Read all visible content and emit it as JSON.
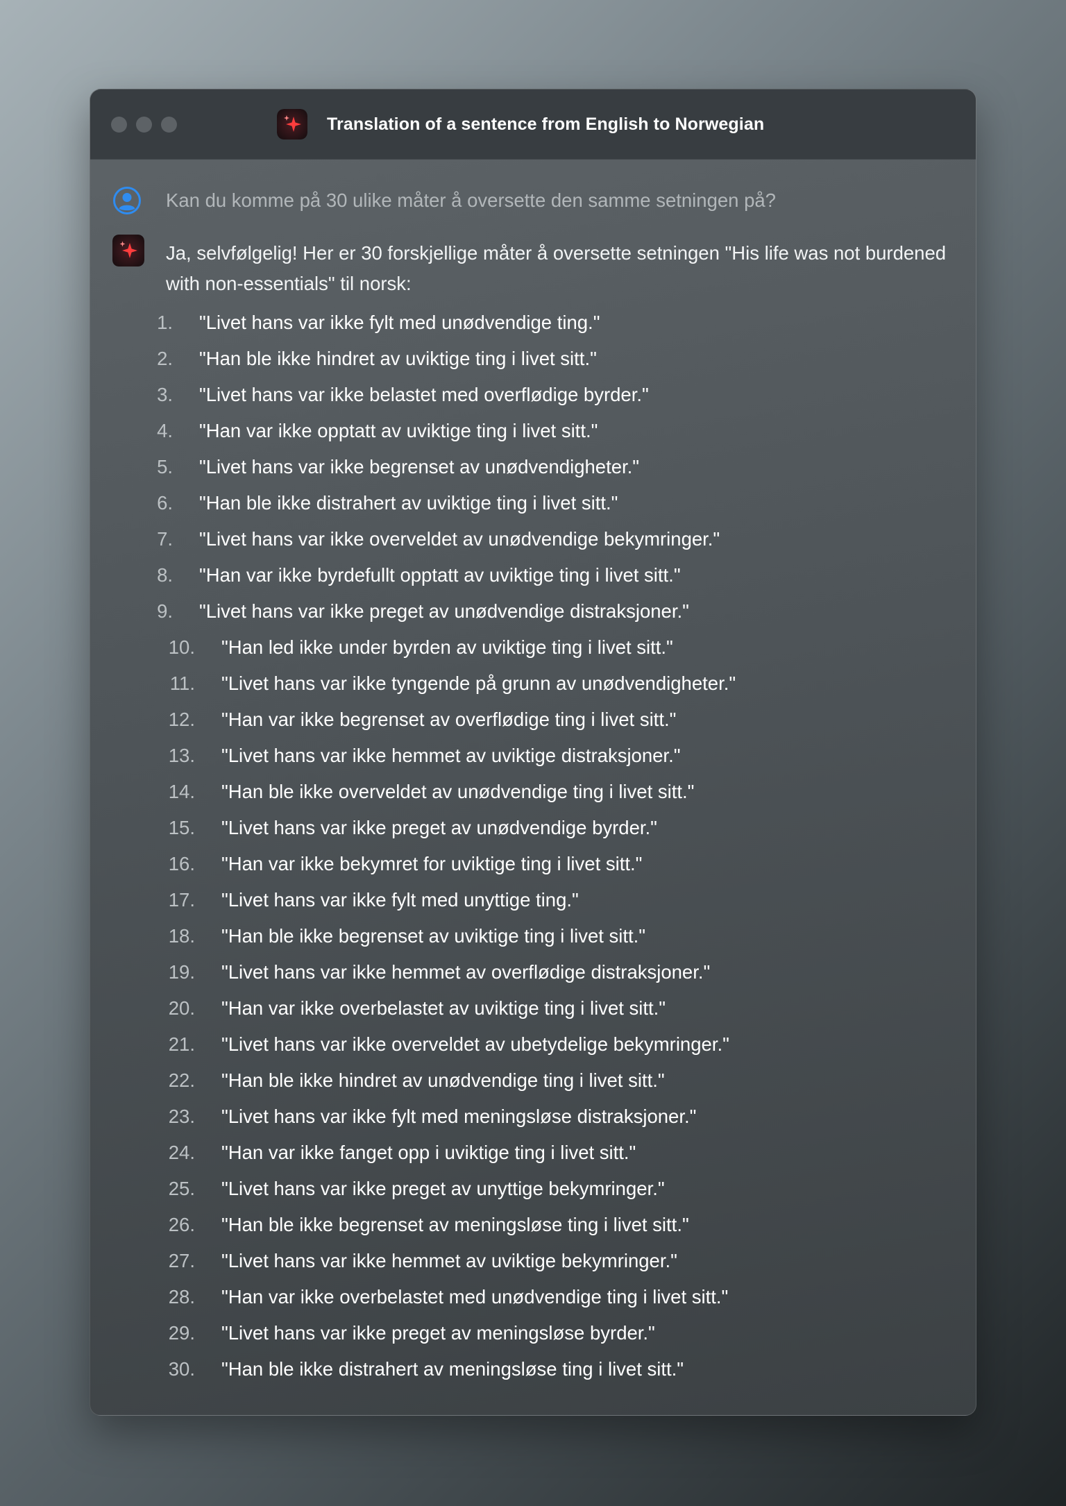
{
  "window": {
    "title": "Translation of a sentence from English to Norwegian",
    "controls": [
      "close",
      "minimize",
      "maximize"
    ],
    "app_icon": "sparkle-icon"
  },
  "conversation": {
    "user_message": "Kan du komme på 30 ulike måter å oversette den samme setningen på?",
    "assistant_intro": "Ja, selvfølgelig! Her er 30 forskjellige måter å oversette setningen \"His life was not burdened with non-essentials\" til norsk:",
    "items": [
      {
        "n": "1.",
        "text": "\"Livet hans var ikke fylt med unødvendige ting.\""
      },
      {
        "n": "2.",
        "text": "\"Han ble ikke hindret av uviktige ting i livet sitt.\""
      },
      {
        "n": "3.",
        "text": "\"Livet hans var ikke belastet med overflødige byrder.\""
      },
      {
        "n": "4.",
        "text": "\"Han var ikke opptatt av uviktige ting i livet sitt.\""
      },
      {
        "n": "5.",
        "text": "\"Livet hans var ikke begrenset av unødvendigheter.\""
      },
      {
        "n": "6.",
        "text": "\"Han ble ikke distrahert av uviktige ting i livet sitt.\""
      },
      {
        "n": "7.",
        "text": "\"Livet hans var ikke overveldet av unødvendige bekymringer.\""
      },
      {
        "n": "8.",
        "text": "\"Han var ikke byrdefullt opptatt av uviktige ting i livet sitt.\""
      },
      {
        "n": "9.",
        "text": "\"Livet hans var ikke preget av unødvendige distraksjoner.\""
      },
      {
        "n": "10.",
        "text": "\"Han led ikke under byrden av uviktige ting i livet sitt.\""
      },
      {
        "n": "11.",
        "text": "\"Livet hans var ikke tyngende på grunn av unødvendigheter.\""
      },
      {
        "n": "12.",
        "text": "\"Han var ikke begrenset av overflødige ting i livet sitt.\""
      },
      {
        "n": "13.",
        "text": "\"Livet hans var ikke hemmet av uviktige distraksjoner.\""
      },
      {
        "n": "14.",
        "text": "\"Han ble ikke overveldet av unødvendige ting i livet sitt.\""
      },
      {
        "n": "15.",
        "text": "\"Livet hans var ikke preget av unødvendige byrder.\""
      },
      {
        "n": "16.",
        "text": "\"Han var ikke bekymret for uviktige ting i livet sitt.\""
      },
      {
        "n": "17.",
        "text": "\"Livet hans var ikke fylt med unyttige ting.\""
      },
      {
        "n": "18.",
        "text": "\"Han ble ikke begrenset av uviktige ting i livet sitt.\""
      },
      {
        "n": "19.",
        "text": "\"Livet hans var ikke hemmet av overflødige distraksjoner.\""
      },
      {
        "n": "20.",
        "text": "\"Han var ikke overbelastet av uviktige ting i livet sitt.\""
      },
      {
        "n": "21.",
        "text": "\"Livet hans var ikke overveldet av ubetydelige bekymringer.\""
      },
      {
        "n": "22.",
        "text": "\"Han ble ikke hindret av unødvendige ting i livet sitt.\""
      },
      {
        "n": "23.",
        "text": "\"Livet hans var ikke fylt med meningsløse distraksjoner.\""
      },
      {
        "n": "24.",
        "text": "\"Han var ikke fanget opp i uviktige ting i livet sitt.\""
      },
      {
        "n": "25.",
        "text": "\"Livet hans var ikke preget av unyttige bekymringer.\""
      },
      {
        "n": "26.",
        "text": "\"Han ble ikke begrenset av meningsløse ting i livet sitt.\""
      },
      {
        "n": "27.",
        "text": "\"Livet hans var ikke hemmet av uviktige bekymringer.\""
      },
      {
        "n": "28.",
        "text": "\"Han var ikke overbelastet med unødvendige ting i livet sitt.\""
      },
      {
        "n": "29.",
        "text": "\"Livet hans var ikke preget av meningsløse byrder.\""
      },
      {
        "n": "30.",
        "text": "\"Han ble ikke distrahert av meningsløse ting i livet sitt.\""
      }
    ]
  },
  "colors": {
    "accent_user": "#2f8cf0",
    "ai_icon_bg": "#1e1416",
    "ai_icon_star": "#ff3b3b"
  }
}
